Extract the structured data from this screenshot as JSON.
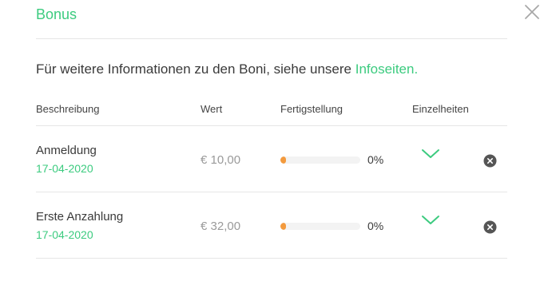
{
  "dialog": {
    "title": "Bonus",
    "close_icon": "close-icon"
  },
  "intro": {
    "text": "Für weitere Informationen zu den Boni, siehe unsere ",
    "link": "Infoseiten."
  },
  "table": {
    "headers": {
      "description": "Beschreibung",
      "value": "Wert",
      "completion": "Fertigstellung",
      "details": "Einzelheiten"
    },
    "rows": [
      {
        "description": "Anmeldung",
        "date": "17-04-2020",
        "value": "€ 10,00",
        "completion_label": "0%",
        "completion": 0
      },
      {
        "description": "Erste Anzahlung",
        "date": "17-04-2020",
        "value": "€ 32,00",
        "completion_label": "0%",
        "completion": 0
      }
    ]
  },
  "colors": {
    "accent": "#3ccb7f",
    "progress": "#f39a3d",
    "progress_track": "#f3f3f3",
    "remove_icon": "#555555"
  }
}
